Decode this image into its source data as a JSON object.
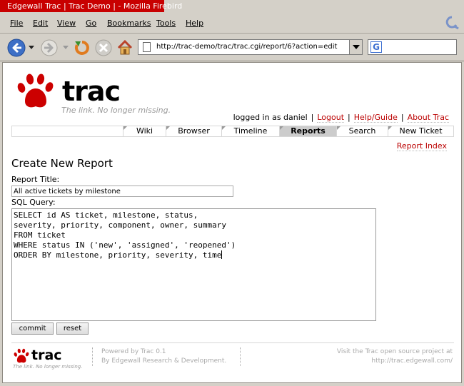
{
  "window": {
    "title": "Edgewall Trac | Trac Demo | - Mozilla Firebird"
  },
  "menubar": {
    "items": [
      "File",
      "Edit",
      "View",
      "Go",
      "Bookmarks",
      "Tools",
      "Help"
    ]
  },
  "navbar": {
    "url": "http://trac-demo/trac/trac.cgi/report/6?action=edit",
    "search_value": ""
  },
  "site": {
    "logo_text": "trac",
    "tagline": "The link. No longer missing."
  },
  "metanav": {
    "logged_in": "logged in as daniel",
    "logout": "Logout",
    "help": "Help/Guide",
    "about": "About Trac"
  },
  "mainnav": {
    "tabs": [
      "Wiki",
      "Browser",
      "Timeline",
      "Reports",
      "Search",
      "New Ticket"
    ],
    "active": "Reports"
  },
  "ctxtnav": {
    "report_index": "Report Index"
  },
  "form": {
    "heading": "Create New Report",
    "title_label": "Report Title:",
    "title_value": "All active tickets by milestone",
    "sql_label": "SQL Query:",
    "sql_value": "SELECT id AS ticket, milestone, status,\nseverity, priority, component, owner, summary\nFROM ticket\nWHERE status IN ('new', 'assigned', 'reopened')\nORDER BY milestone, priority, severity, time",
    "commit_label": "commit",
    "reset_label": "reset"
  },
  "footer": {
    "logo_text": "trac",
    "tagline": "The link. No longer missing.",
    "powered_by": "Powered by Trac 0.1",
    "by_line": "By Edgewall Research & Development.",
    "visit": "Visit the Trac open source project at",
    "visit_url": "http://trac.edgewall.com/"
  },
  "colors": {
    "trac_red": "#cc0000",
    "link_red": "#bb0000",
    "title_bar": "#c80000"
  }
}
